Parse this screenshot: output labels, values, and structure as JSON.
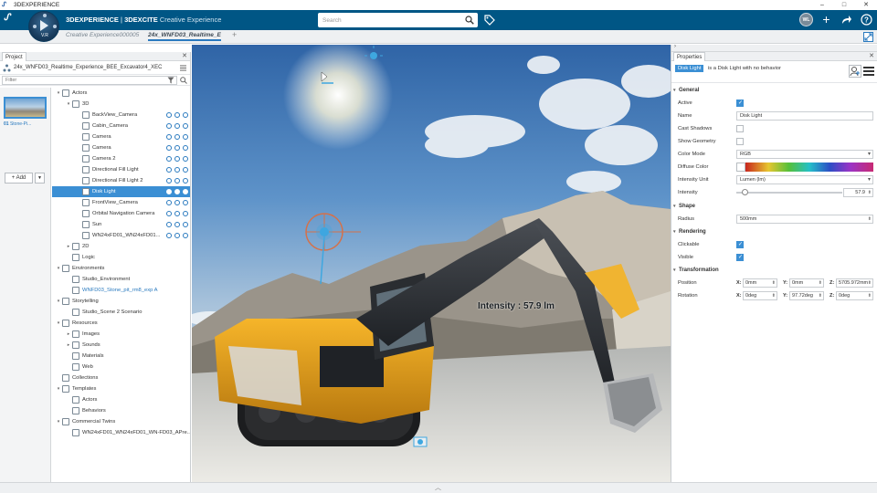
{
  "window": {
    "title": "3DEXPERIENCE",
    "controls": [
      "–",
      "□",
      "✕"
    ]
  },
  "topbar": {
    "compass_version": "V.R",
    "brand_main": "3DEXPERIENCE",
    "brand_separator": " | ",
    "brand_app": "3DEXCITE",
    "brand_sub": " Creative Experience",
    "search_placeholder": "Search",
    "avatar_initials": "WL"
  },
  "tabs": [
    {
      "label": "Creative Experience000005"
    },
    {
      "label": "24x_WNFD03_Realtime_E"
    },
    {
      "label": "+"
    }
  ],
  "project_panel": {
    "tab_label": "Project",
    "project_name": "24x_WNFD03_Realtime_Experience_BEE_Excavator4_XEC",
    "filter_placeholder": "Filter",
    "thumbnail_label": "Stone-Pi...",
    "thumbnail_badge": "01",
    "add_label": "+ Add",
    "tree": [
      {
        "label": "Actors",
        "indent": 0,
        "toggle": "▾"
      },
      {
        "label": "3D",
        "indent": 1,
        "toggle": "▾"
      },
      {
        "label": "BackView_Camera",
        "indent": 2,
        "toggle": "",
        "acts": true
      },
      {
        "label": "Cabin_Camera",
        "indent": 2,
        "toggle": "",
        "acts": true
      },
      {
        "label": "Camera",
        "indent": 2,
        "toggle": "",
        "acts": true
      },
      {
        "label": "Camera",
        "indent": 2,
        "toggle": "",
        "acts": true
      },
      {
        "label": "Camera 2",
        "indent": 2,
        "toggle": "",
        "acts": true
      },
      {
        "label": "Directional Fill Light",
        "indent": 2,
        "toggle": "",
        "acts": true
      },
      {
        "label": "Directional Fill Light 2",
        "indent": 2,
        "toggle": "",
        "acts": true
      },
      {
        "label": "Disk Light",
        "indent": 2,
        "toggle": "",
        "acts": true,
        "selected": true
      },
      {
        "label": "FrontView_Camera",
        "indent": 2,
        "toggle": "",
        "acts": true
      },
      {
        "label": "Orbital Navigation Camera",
        "indent": 2,
        "toggle": "",
        "acts": true
      },
      {
        "label": "Sun",
        "indent": 2,
        "toggle": "",
        "acts": true
      },
      {
        "label": "WN24xFD01_WN24xFD01...",
        "indent": 2,
        "toggle": "",
        "acts": true
      },
      {
        "label": "2D",
        "indent": 1,
        "toggle": "▸"
      },
      {
        "label": "Logic",
        "indent": 1,
        "toggle": ""
      },
      {
        "label": "Environments",
        "indent": 0,
        "toggle": "▾"
      },
      {
        "label": "Studio_Environment",
        "indent": 1,
        "toggle": ""
      },
      {
        "label": "WNFD03_Stone_pit_rm8_exp A",
        "indent": 1,
        "toggle": "",
        "blue": true
      },
      {
        "label": "Storytelling",
        "indent": 0,
        "toggle": "▾"
      },
      {
        "label": "Studio_Scene 2 Scenario",
        "indent": 1,
        "toggle": ""
      },
      {
        "label": "Resources",
        "indent": 0,
        "toggle": "▾"
      },
      {
        "label": "Images",
        "indent": 1,
        "toggle": "▸"
      },
      {
        "label": "Sounds",
        "indent": 1,
        "toggle": "▸"
      },
      {
        "label": "Materials",
        "indent": 1,
        "toggle": ""
      },
      {
        "label": "Web",
        "indent": 1,
        "toggle": ""
      },
      {
        "label": "Collections",
        "indent": 0,
        "toggle": ""
      },
      {
        "label": "Templates",
        "indent": 0,
        "toggle": "▾"
      },
      {
        "label": "Actors",
        "indent": 1,
        "toggle": ""
      },
      {
        "label": "Behaviors",
        "indent": 1,
        "toggle": ""
      },
      {
        "label": "Commercial Twins",
        "indent": 0,
        "toggle": "▾"
      },
      {
        "label": "WN24xFD01_WN24xFD01_WN-FD03_APre...",
        "indent": 1,
        "toggle": ""
      }
    ]
  },
  "viewport": {
    "intensity_label": "Intensity : 57.9 lm"
  },
  "properties": {
    "tab_label": "Properties",
    "object_badge": "Disk Light",
    "object_desc": "is a Disk Light with no behavior",
    "sections": {
      "general": "General",
      "shape": "Shape",
      "rendering": "Rendering",
      "transformation": "Transformation"
    },
    "general": {
      "active_label": "Active",
      "active": true,
      "name_label": "Name",
      "name_value": "Disk Light",
      "cast_shadows_label": "Cast Shadows",
      "cast_shadows": false,
      "show_geometry_label": "Show Geometry",
      "show_geometry": false,
      "color_mode_label": "Color Mode",
      "color_mode_value": "RGB",
      "diffuse_color_label": "Diffuse Color",
      "intensity_unit_label": "Intensity Unit",
      "intensity_unit_value": "Lumen (lm)",
      "intensity_label": "Intensity",
      "intensity_value": "57.9",
      "intensity_fraction": 0.05
    },
    "shape": {
      "radius_label": "Radius",
      "radius_value": "500mm"
    },
    "rendering": {
      "clickable_label": "Clickable",
      "clickable": true,
      "visible_label": "Visible",
      "visible": true
    },
    "transformation": {
      "position_label": "Position",
      "position": {
        "x": "0mm",
        "y": "0mm",
        "z": "5705.972mm"
      },
      "rotation_label": "Rotation",
      "rotation": {
        "x": "0deg",
        "y": "97.72deg",
        "z": "0deg"
      },
      "axis_x": "X:",
      "axis_y": "Y:",
      "axis_z": "Z:"
    }
  },
  "colors": {
    "topbar": "#005685",
    "selection": "#3b8fd4",
    "accent": "#2a7abf"
  }
}
